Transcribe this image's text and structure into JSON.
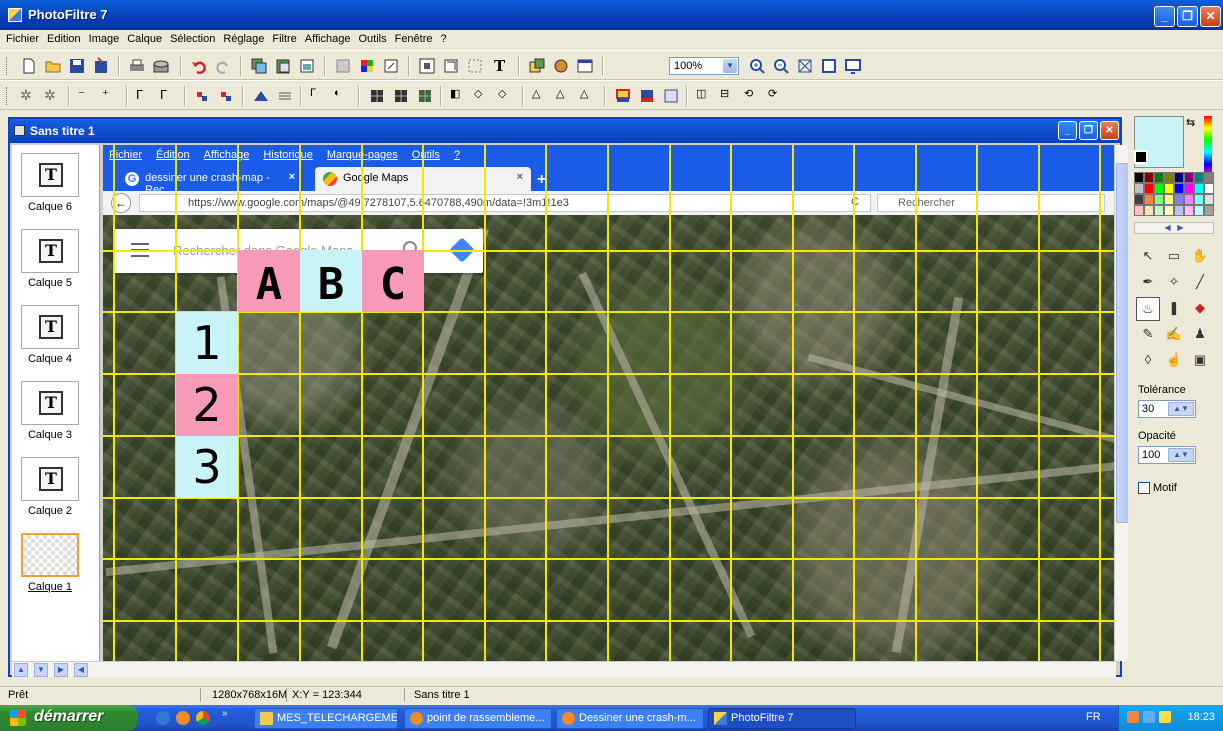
{
  "app": {
    "title": "PhotoFiltre 7"
  },
  "menu": [
    "Fichier",
    "Edition",
    "Image",
    "Calque",
    "Sélection",
    "Réglage",
    "Filtre",
    "Affichage",
    "Outils",
    "Fenêtre",
    "?"
  ],
  "toolbar": {
    "zoom_value": "100%"
  },
  "document": {
    "title": "Sans titre 1"
  },
  "layers": [
    {
      "label": "Calque 6"
    },
    {
      "label": "Calque 5"
    },
    {
      "label": "Calque 4"
    },
    {
      "label": "Calque 3"
    },
    {
      "label": "Calque 2"
    },
    {
      "label": "Calque 1"
    }
  ],
  "layer_thumb_glyph": "T",
  "browser": {
    "menu": [
      "Fichier",
      "Édition",
      "Affichage",
      "Historique",
      "Marque-pages",
      "Outils",
      "?"
    ],
    "tab1": "dessiner une crash-map - Rec...",
    "tab2": "Google Maps",
    "tab_close": "×",
    "url": "https://www.google.com/maps/@49.7278107,5.6470788,490m/data=!3m1!1e3",
    "search_placeholder": "Rechercher",
    "maps_search_placeholder": "Rechercher dans Google Maps"
  },
  "grid_labels": {
    "columns": [
      "A",
      "B",
      "C"
    ],
    "rows": [
      "1",
      "2",
      "3"
    ]
  },
  "palette": {
    "tolerance_label": "Tolérance",
    "tolerance_value": "30",
    "opacity_label": "Opacité",
    "opacity_value": "100",
    "motif_label": "Motif",
    "colors": [
      "#000000",
      "#800000",
      "#008000",
      "#808000",
      "#000080",
      "#800080",
      "#008080",
      "#808080",
      "#c0c0c0",
      "#ff0000",
      "#00ff00",
      "#ffff00",
      "#0000ff",
      "#ff00ff",
      "#00ffff",
      "#ffffff",
      "#404040",
      "#ff8040",
      "#80ff80",
      "#ffff80",
      "#8080ff",
      "#ff80ff",
      "#80ffff",
      "#e0e0e0",
      "#ffc0c0",
      "#ffe0c0",
      "#c0ffc0",
      "#ffffc0",
      "#c0c0ff",
      "#ffc0ff",
      "#c0ffff",
      "#a0a0a0"
    ]
  },
  "status": {
    "state": "Prêt",
    "size": "1280x768x16M",
    "coords": "X:Y = 123:344",
    "doc": "Sans titre 1"
  },
  "taskbar": {
    "start": "démarrer",
    "tasks": [
      {
        "label": "MES_TELECHARGEME...",
        "icon": "folder"
      },
      {
        "label": "point de rassembleme...",
        "icon": "firefox"
      },
      {
        "label": "Dessiner une crash-m...",
        "icon": "firefox"
      },
      {
        "label": "PhotoFiltre 7",
        "icon": "photofiltre"
      }
    ],
    "lang": "FR",
    "clock": "18:23"
  },
  "colors": {
    "grid": "#f4e800",
    "cell_pink": "#f79ab8",
    "cell_cyan": "#c8f4f8",
    "xp_blue": "#0a44c8"
  }
}
